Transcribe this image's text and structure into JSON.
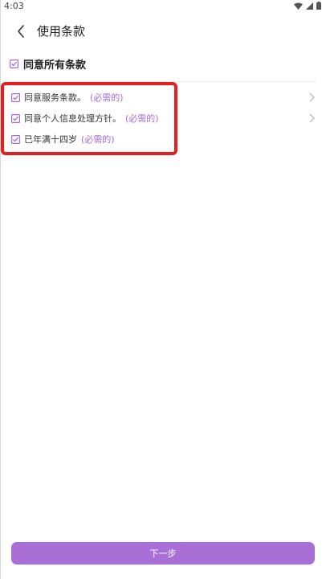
{
  "status_bar": {
    "time": "4:03"
  },
  "header": {
    "title": "使用条款",
    "back_icon": "chevron-left-icon"
  },
  "agree_all": {
    "label": "同意所有条款",
    "checked": true
  },
  "terms": [
    {
      "text": "同意服务条款。",
      "required": "(必需的)",
      "has_chevron": true,
      "checked": true
    },
    {
      "text": "同意个人信息处理方针。",
      "required": "(必需的)",
      "has_chevron": true,
      "checked": true
    },
    {
      "text": "已年满十四岁",
      "required": "(必需的)",
      "has_chevron": false,
      "checked": true
    }
  ],
  "footer": {
    "next_label": "下一步"
  },
  "colors": {
    "accent": "#a96fd6",
    "required_text": "#a56bd3",
    "highlight": "#e3201f"
  }
}
